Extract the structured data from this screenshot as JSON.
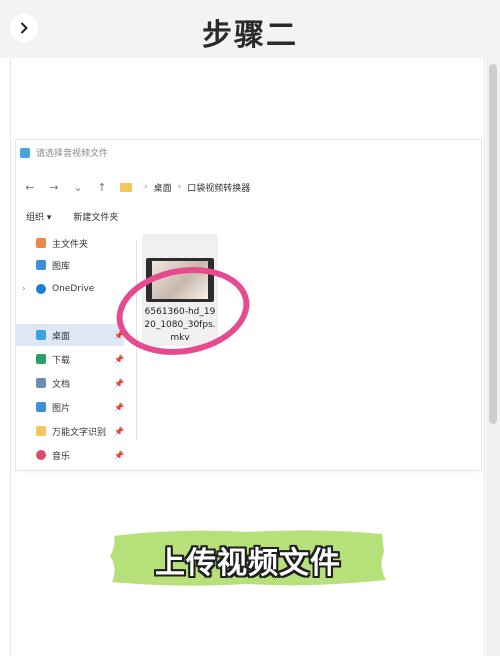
{
  "header": {
    "title": "步骤二",
    "back_icon": "chevron-right-icon"
  },
  "dialog": {
    "title": "请选择音视频文件",
    "address": {
      "breadcrumbs": [
        "桌面",
        "口袋视频转换器"
      ]
    },
    "toolbar": {
      "organize": "组织 ▾",
      "new_folder": "新建文件夹"
    },
    "nav_items": [
      {
        "label": "主文件夹",
        "icon": "home-icon",
        "color": "#e8884a",
        "pinned": false
      },
      {
        "label": "图库",
        "icon": "gallery-icon",
        "color": "#3d8fd6",
        "pinned": false
      },
      {
        "label": "OneDrive",
        "icon": "cloud-icon",
        "color": "#1e7bd8",
        "pinned": false
      },
      {
        "label": "桌面",
        "icon": "desktop-icon",
        "color": "#3aa3e3",
        "pinned": true,
        "selected": true
      },
      {
        "label": "下载",
        "icon": "download-icon",
        "color": "#2b9c6a",
        "pinned": true
      },
      {
        "label": "文档",
        "icon": "document-icon",
        "color": "#6c8ab3",
        "pinned": true
      },
      {
        "label": "图片",
        "icon": "picture-icon",
        "color": "#3d8fd6",
        "pinned": true
      },
      {
        "label": "万能文字识别",
        "icon": "folder-icon",
        "color": "#f4c55c",
        "pinned": true
      },
      {
        "label": "音乐",
        "icon": "music-icon",
        "color": "#d6506b",
        "pinned": true
      }
    ],
    "file": {
      "name_lines": [
        "6561360-hd_19",
        "20_1080_30fps.",
        "mkv"
      ]
    }
  },
  "banner": {
    "text": "上传视频文件"
  },
  "colors": {
    "annotation": "#e64a8f",
    "banner_brush": "#b6e07a"
  }
}
